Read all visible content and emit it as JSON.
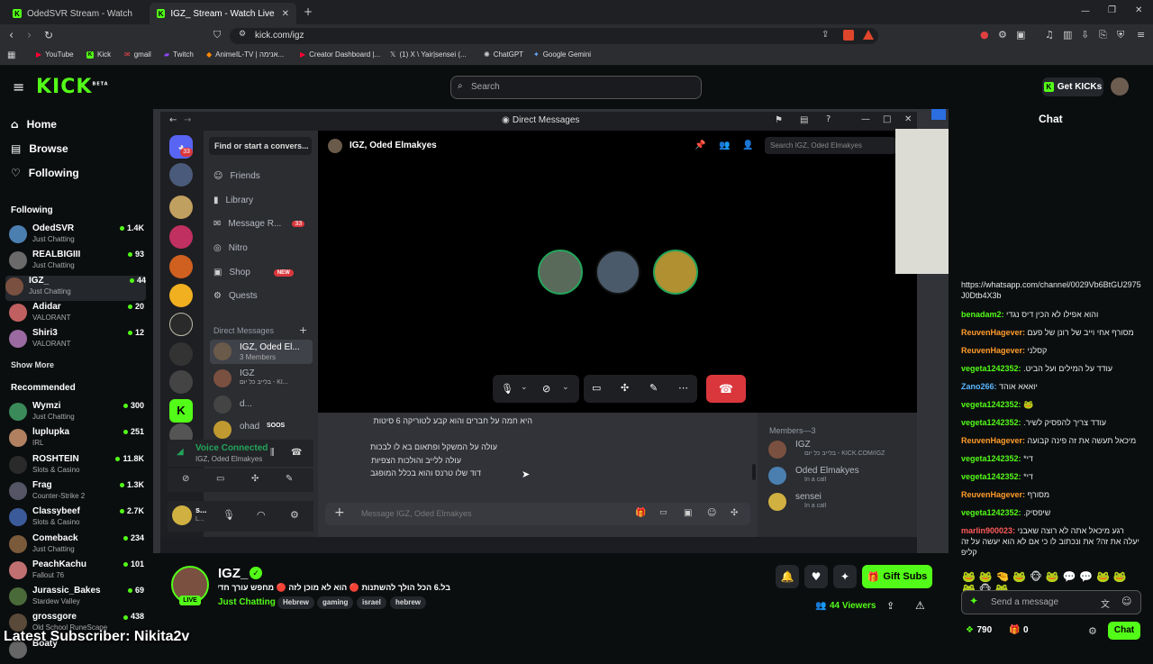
{
  "browser": {
    "tabs": [
      {
        "title": "OdedSVR Stream - Watch Live on Kick"
      },
      {
        "title": "IGZ_ Stream - Watch Live on Kick"
      }
    ],
    "url": "kick.com/igz",
    "bookmarks": [
      "YouTube",
      "Kick",
      "gmail",
      "Twitch",
      "AnimeIL-TV | אנימה...",
      "Creator Dashboard |...",
      "(1) X \\ Yair|sensei (...",
      "ChatGPT",
      "Google Gemini"
    ]
  },
  "header": {
    "search_placeholder": "Search",
    "get_kicks": "Get KICKs"
  },
  "sidebar": {
    "nav": [
      "Home",
      "Browse",
      "Following"
    ],
    "following_title": "Following",
    "following": [
      {
        "name": "OdedSVR",
        "game": "Just Chatting",
        "viewers": "1.4K",
        "color": "#4a7fb0"
      },
      {
        "name": "REALBIGIII",
        "game": "Just Chatting",
        "viewers": "93",
        "color": "#6a6a6a"
      },
      {
        "name": "IGZ_",
        "game": "Just Chatting",
        "viewers": "44",
        "color": "#7a5040"
      },
      {
        "name": "Adidar",
        "game": "VALORANT",
        "viewers": "20",
        "color": "#c06060"
      },
      {
        "name": "Shiri3",
        "game": "VALORANT",
        "viewers": "12",
        "color": "#9a6aa0"
      }
    ],
    "show_more": "Show More",
    "recommended_title": "Recommended",
    "recommended": [
      {
        "name": "Wymzi",
        "game": "Just Chatting",
        "viewers": "300",
        "color": "#3a8a5a"
      },
      {
        "name": "luplupka",
        "game": "IRL",
        "viewers": "251",
        "color": "#b08060"
      },
      {
        "name": "ROSHTEIN",
        "game": "Slots & Casino",
        "viewers": "11.8K",
        "color": "#2a2a2a"
      },
      {
        "name": "Frag",
        "game": "Counter-Strike 2",
        "viewers": "1.3K",
        "color": "#555566"
      },
      {
        "name": "Classybeef",
        "game": "Slots & Casino",
        "viewers": "2.7K",
        "color": "#3a5a9a"
      },
      {
        "name": "Comeback",
        "game": "Just Chatting",
        "viewers": "234",
        "color": "#7a5a3a"
      },
      {
        "name": "PeachKachu",
        "game": "Fallout 76",
        "viewers": "101",
        "color": "#c07070"
      },
      {
        "name": "Jurassic_Bakes",
        "game": "Stardew Valley",
        "viewers": "69",
        "color": "#4a6a3a"
      },
      {
        "name": "grossgore",
        "game": "Old School RuneScape",
        "viewers": "438",
        "color": "#5a4a3a"
      },
      {
        "name": "Boaty",
        "game": "",
        "viewers": "",
        "color": "#666"
      }
    ]
  },
  "discord": {
    "title": "Direct Messages",
    "find": "Find or start a convers...",
    "server_badge": "33",
    "nav": [
      "Friends",
      "Library",
      "Message R...",
      "Nitro",
      "Shop",
      "Quests"
    ],
    "message_requests_badge": "33",
    "shop_badge": "NEW",
    "dm_header": "Direct Messages",
    "dms": [
      {
        "name": "IGZ, Oded El...",
        "sub": "3 Members"
      },
      {
        "name": "IGZ",
        "sub": "בלייב כל יום - KI..."
      },
      {
        "name": "d...",
        "sub": ""
      },
      {
        "name": "ohad",
        "sub": "SOOS"
      }
    ],
    "voice_connected": "Voice Connected",
    "voice_sub": "IGZ, Oded Elmakyes",
    "user_short": "s...",
    "user_sub": "L...",
    "chat_title": "IGZ, Oded Elmakyes",
    "chat_search": "Search IGZ, Oded Elmakyes",
    "messages": [
      "היא חמה על חברים והוא קבע לטוריקה 6 סיטות",
      "עולה על המשקל ופתאום בא לו לבכות",
      "עולה ללייב והולכות הצפיות",
      "דוד שלו טרנס והוא בכלל המופגב"
    ],
    "message_placeholder": "Message IGZ, Oded Elmakyes",
    "members_title": "Members—3",
    "members": [
      {
        "name": "IGZ",
        "status": "בלייב כל יום - KICK.COM/IGZ",
        "color": "#7a5040"
      },
      {
        "name": "Oded Elmakyes",
        "status": "In a call",
        "color": "#4a7fb0"
      },
      {
        "name": "sensei",
        "status": "In a call",
        "color": "#d0b040"
      }
    ]
  },
  "chat": {
    "title": "Chat",
    "messages": [
      {
        "user": "",
        "text": "https://whatsapp.com/channel/0029Vb6BtGU2975J0Dtb4X3b",
        "cls": ""
      },
      {
        "user": "benadam2:",
        "text": "והוא אפילו לא הכין דיס נגדי",
        "cls": ""
      },
      {
        "user": "ReuvenHagever:",
        "text": "מסורף אחי וייב של רונן של פעם",
        "cls": "r"
      },
      {
        "user": "ReuvenHagever:",
        "text": "קסלני",
        "cls": "r"
      },
      {
        "user": "vegeta1242352:",
        "text": "עודד על המילים ועל הביט.",
        "cls": ""
      },
      {
        "user": "Zano266:",
        "text": "יואאא אוהד",
        "cls": "b"
      },
      {
        "user": "vegeta1242352:",
        "text": "🐸",
        "cls": ""
      },
      {
        "user": "vegeta1242352:",
        "text": "עודד צריך להפסיק לשיר.",
        "cls": ""
      },
      {
        "user": "ReuvenHagever:",
        "text": "מיכאל תעשה את זה פינה קבועה",
        "cls": "r"
      },
      {
        "user": "vegeta1242352:",
        "text": "די*",
        "cls": ""
      },
      {
        "user": "vegeta1242352:",
        "text": "די*",
        "cls": ""
      },
      {
        "user": "ReuvenHagever:",
        "text": "מסורף",
        "cls": "r"
      },
      {
        "user": "vegeta1242352:",
        "text": "שיפסיק.",
        "cls": ""
      },
      {
        "user": "marlin900023:",
        "text": "רגע מיכאל אתה לא רוצה שאבני יעלה את זה? את ונכתוב לו כי אם לא הוא יעשה על זה קליפ",
        "cls": "red"
      }
    ],
    "send_placeholder": "Send a message",
    "points": "790",
    "count": "0",
    "chat_button": "Chat"
  },
  "stream": {
    "name": "IGZ_",
    "title": "בל.6 הכל הולך להשתנות 🔴 הוא לא מוכן לזה 🔴 מחפש עורך חדש",
    "category": "Just Chatting",
    "tags": [
      "Hebrew",
      "gaming",
      "israel",
      "hebrew"
    ],
    "live": "LIVE",
    "viewers": "44 Viewers",
    "gift_subs": "Gift Subs",
    "latest_sub": "Latest Subscriber: Nikita2v"
  },
  "colors": {
    "kick_green": "#53fc18",
    "discord_red": "#da373c"
  }
}
